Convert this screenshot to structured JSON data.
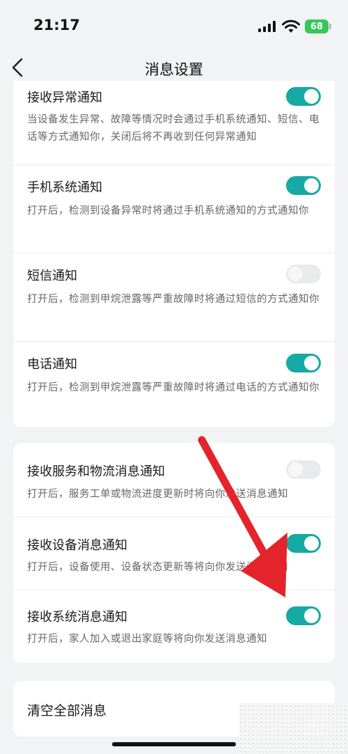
{
  "status_bar": {
    "time": "21:17",
    "battery": "68",
    "icons": [
      "cellular-signal-icon",
      "wifi-icon",
      "battery-charging-icon"
    ]
  },
  "nav": {
    "title": "消息设置",
    "back_icon": "chevron-left-icon"
  },
  "alert_group": {
    "items": [
      {
        "title": "接收异常通知",
        "desc": "当设备发生异常、故障等情况时会通过手机系统通知、短信、电话等方式通知你，关闭后将不再收到任何异常通知",
        "enabled": true
      },
      {
        "title": "手机系统通知",
        "desc": "打开后，检测到设备异常时将通过手机系统通知的方式通知你",
        "enabled": true
      },
      {
        "title": "短信通知",
        "desc": "打开后，检测到甲烷泄露等严重故障时将通过短信的方式通知你",
        "enabled": false
      },
      {
        "title": "电话通知",
        "desc": "打开后，检测到甲烷泄露等严重故障时将通过电话的方式通知你",
        "enabled": true
      }
    ]
  },
  "message_group": {
    "items": [
      {
        "title": "接收服务和物流消息通知",
        "desc": "打开后，服务工单或物流进度更新时将向你发送消息通知",
        "enabled": false
      },
      {
        "title": "接收设备消息通知",
        "desc": "打开后，设备使用、设备状态更新等将向你发送消息通知",
        "enabled": true
      },
      {
        "title": "接收系统消息通知",
        "desc": "打开后，家人加入或退出家庭等将向你发送消息通知",
        "enabled": true
      }
    ]
  },
  "clear_all": {
    "label": "清空全部消息"
  },
  "colors": {
    "toggle_on": "#17a9a3",
    "toggle_off": "#e9eaec",
    "annotation_arrow": "#e3242b",
    "background": "#f2f3f5"
  }
}
